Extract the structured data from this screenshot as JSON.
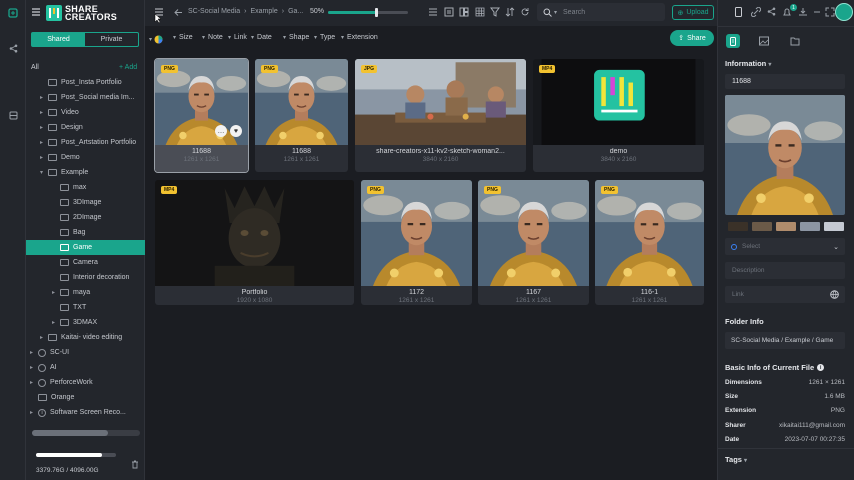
{
  "app": {
    "logo_line1": "SHARE",
    "logo_line2": "CREATORS"
  },
  "colors": {
    "accent": "#1aa58c",
    "badge": "#f2c230",
    "bg": "#1b1d22",
    "panel": "#23262c"
  },
  "sidebar": {
    "tabs": [
      "Shared",
      "Private"
    ],
    "all_label": "All",
    "add_label": "+ Add",
    "tree": [
      {
        "label": "Post_Insta Portfolio",
        "arrow": false,
        "icon": "folder"
      },
      {
        "label": "Post_Social media Im...",
        "arrow": true,
        "icon": "folder"
      },
      {
        "label": "Video",
        "arrow": true,
        "icon": "folder"
      },
      {
        "label": "Design",
        "arrow": true,
        "icon": "folder"
      },
      {
        "label": "Post_Artstation Portfolio",
        "arrow": true,
        "icon": "folder"
      },
      {
        "label": "Demo",
        "arrow": true,
        "icon": "folder"
      },
      {
        "label": "Example",
        "arrow": true,
        "icon": "folder",
        "open": true
      },
      {
        "label": "max",
        "arrow": false,
        "icon": "folder",
        "child": true
      },
      {
        "label": "3DImage",
        "arrow": false,
        "icon": "folder",
        "child": true
      },
      {
        "label": "2DImage",
        "arrow": false,
        "icon": "folder",
        "child": true
      },
      {
        "label": "Bag",
        "arrow": false,
        "icon": "folder",
        "child": true
      },
      {
        "label": "Game",
        "arrow": false,
        "icon": "folder",
        "child": true,
        "selected": true
      },
      {
        "label": "Camera",
        "arrow": false,
        "icon": "folder",
        "child": true
      },
      {
        "label": "Interior decoration",
        "arrow": false,
        "icon": "folder",
        "child": true
      },
      {
        "label": "maya",
        "arrow": true,
        "icon": "folder",
        "child": true
      },
      {
        "label": "TXT",
        "arrow": false,
        "icon": "folder",
        "child": true
      },
      {
        "label": "3DMAX",
        "arrow": true,
        "icon": "folder",
        "child": true
      },
      {
        "label": "Kaitai- video editing",
        "arrow": true,
        "icon": "folder"
      },
      {
        "label": "SC-UI",
        "arrow": true,
        "icon": "category",
        "root": true
      },
      {
        "label": "AI",
        "arrow": true,
        "icon": "category",
        "root": true
      },
      {
        "label": "PerforceWork",
        "arrow": true,
        "icon": "category",
        "root": true
      },
      {
        "label": "Orange",
        "arrow": false,
        "icon": "folder",
        "root": true
      },
      {
        "label": "Software Screen Reco...",
        "arrow": true,
        "icon": "info",
        "root": true
      }
    ],
    "storage": "3379.76G / 4096.00G",
    "storage_fraction": 0.825
  },
  "topbar": {
    "breadcrumb": [
      "SC-Social Media",
      "Example",
      "Ga..."
    ],
    "zoom": "50%",
    "zoom_fraction": 0.6,
    "search_placeholder": "Search",
    "upload_label": "Upload"
  },
  "filters": {
    "items": [
      "Size",
      "Note",
      "Link",
      "Date",
      "Shape",
      "Type",
      "Extension"
    ],
    "share_label": "Share"
  },
  "files": [
    {
      "name": "11688",
      "dims": "1261 x 1261",
      "badge": "PNG",
      "kind": "face",
      "selected": true
    },
    {
      "name": "11688",
      "dims": "1261 x 1261",
      "badge": "PNG",
      "kind": "face"
    },
    {
      "name": "share-creators-x11-kv2-sketch-woman2...",
      "dims": "3840 x 2160",
      "badge": "JPG",
      "kind": "scene"
    },
    {
      "name": "demo",
      "dims": "3840 x 2160",
      "badge": "MP4",
      "kind": "logo"
    },
    {
      "name": "Portfolio",
      "dims": "1920 x 1080",
      "badge": "MP4",
      "kind": "dark"
    },
    {
      "name": "1172",
      "dims": "1261 x 1261",
      "badge": "PNG",
      "kind": "face"
    },
    {
      "name": "1167",
      "dims": "1261 x 1261",
      "badge": "PNG",
      "kind": "face"
    },
    {
      "name": "116-1",
      "dims": "1261 x 1261",
      "badge": "PNG",
      "kind": "face"
    }
  ],
  "right": {
    "info_title": "Information",
    "file_name": "11688",
    "palette": [
      "#3a3128",
      "#6b5a48",
      "#b08c6c",
      "#8c95a3",
      "#c5cad3"
    ],
    "select_placeholder": "Select",
    "description_placeholder": "Description",
    "link_placeholder": "Link",
    "folder_info_title": "Folder Info",
    "folder_path": "SC-Social Media / Example / Game",
    "basic_title": "Basic Info of Current File",
    "details": [
      {
        "k": "Dimensions",
        "v": "1261 × 1261"
      },
      {
        "k": "Size",
        "v": "1.6 MB"
      },
      {
        "k": "Extension",
        "v": "PNG"
      },
      {
        "k": "Sharer",
        "v": "xikaitai111@gmail.com"
      },
      {
        "k": "Date",
        "v": "2023-07-07 00:27:35"
      }
    ],
    "tags_title": "Tags",
    "notification_count": "1"
  }
}
